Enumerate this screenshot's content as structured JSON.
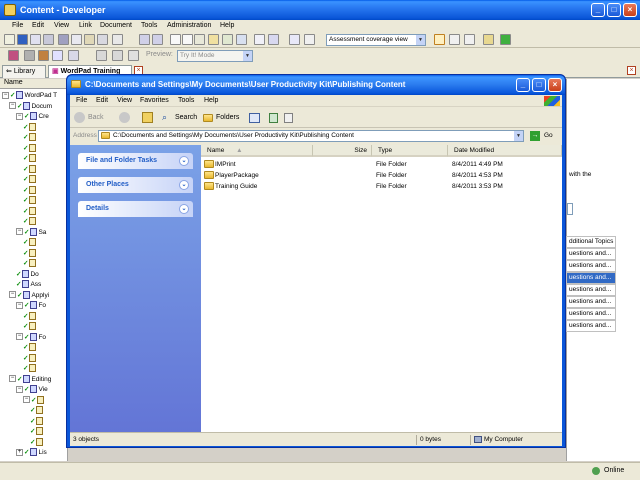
{
  "main_window": {
    "title": "Content - Developer",
    "menu": [
      "File",
      "Edit",
      "View",
      "Link",
      "Document",
      "Tools",
      "Administration",
      "Help"
    ],
    "preview_label": "Preview:",
    "preview_value": "Try It! Mode",
    "view_select": "Assessment coverage view"
  },
  "tabs": {
    "library": "Library",
    "active": "WordPad Training"
  },
  "tree": {
    "header": "Name",
    "rows": [
      {
        "label": "WordPad T",
        "indent": 0,
        "expander": "−"
      },
      {
        "label": "Docum",
        "indent": 1,
        "expander": "−"
      },
      {
        "label": "Cre",
        "indent": 2,
        "expander": "−"
      },
      {
        "label": "",
        "indent": 3,
        "expander": ""
      },
      {
        "label": "",
        "indent": 3,
        "expander": ""
      },
      {
        "label": "",
        "indent": 3,
        "expander": ""
      },
      {
        "label": "",
        "indent": 3,
        "expander": ""
      },
      {
        "label": "",
        "indent": 3,
        "expander": ""
      },
      {
        "label": "",
        "indent": 3,
        "expander": ""
      },
      {
        "label": "",
        "indent": 3,
        "expander": ""
      },
      {
        "label": "",
        "indent": 3,
        "expander": ""
      },
      {
        "label": "",
        "indent": 3,
        "expander": ""
      },
      {
        "label": "",
        "indent": 3,
        "expander": ""
      },
      {
        "label": "Sa",
        "indent": 2,
        "expander": "−"
      },
      {
        "label": "",
        "indent": 3,
        "expander": ""
      },
      {
        "label": "",
        "indent": 3,
        "expander": ""
      },
      {
        "label": "",
        "indent": 3,
        "expander": ""
      },
      {
        "label": "Do",
        "indent": 2,
        "expander": ""
      },
      {
        "label": "Ass",
        "indent": 2,
        "expander": ""
      },
      {
        "label": "Applyi",
        "indent": 1,
        "expander": "−"
      },
      {
        "label": "Fo",
        "indent": 2,
        "expander": "−"
      },
      {
        "label": "",
        "indent": 3,
        "expander": ""
      },
      {
        "label": "",
        "indent": 3,
        "expander": ""
      },
      {
        "label": "Fo",
        "indent": 2,
        "expander": "−"
      },
      {
        "label": "",
        "indent": 3,
        "expander": ""
      },
      {
        "label": "",
        "indent": 3,
        "expander": ""
      },
      {
        "label": "",
        "indent": 3,
        "expander": ""
      },
      {
        "label": "Editing",
        "indent": 1,
        "expander": "−"
      },
      {
        "label": "Vie",
        "indent": 2,
        "expander": "−"
      },
      {
        "label": "",
        "indent": 3,
        "expander": "−"
      },
      {
        "label": "",
        "indent": 4,
        "expander": ""
      },
      {
        "label": "",
        "indent": 4,
        "expander": ""
      },
      {
        "label": "",
        "indent": 4,
        "expander": ""
      },
      {
        "label": "",
        "indent": 4,
        "expander": ""
      },
      {
        "label": "Lis",
        "indent": 2,
        "expander": "+"
      }
    ]
  },
  "right_panel": {
    "text_fragment": "with the",
    "rows": [
      "dditional Topics",
      "uestions and...",
      "uestions and...",
      "uestions and...",
      "uestions and...",
      "uestions and...",
      "uestions and...",
      "uestions and..."
    ],
    "selected_index": 3
  },
  "statusbar": {
    "online": "Online"
  },
  "explorer": {
    "title": "C:\\Documents and Settings\\My Documents\\User Productivity Kit\\Publishing Content",
    "menu": [
      "File",
      "Edit",
      "View",
      "Favorites",
      "Tools",
      "Help"
    ],
    "toolbar": {
      "back": "Back",
      "search": "Search",
      "folders": "Folders"
    },
    "address_label": "Address",
    "address_value": "C:\\Documents and Settings\\My Documents\\User Productivity Kit\\Publishing Content",
    "go": "Go",
    "tasks": [
      "File and Folder Tasks",
      "Other Places",
      "Details"
    ],
    "columns": [
      "Name",
      "Size",
      "Type",
      "Date Modified"
    ],
    "files": [
      {
        "name": "IMPrint",
        "size": "",
        "type": "File Folder",
        "date": "8/4/2011 4:49 PM"
      },
      {
        "name": "PlayerPackage",
        "size": "",
        "type": "File Folder",
        "date": "8/4/2011 4:53 PM"
      },
      {
        "name": "Training Guide",
        "size": "",
        "type": "File Folder",
        "date": "8/4/2011 3:53 PM"
      }
    ],
    "status": {
      "objects": "3 objects",
      "bytes": "0 bytes",
      "location": "My Computer"
    }
  },
  "colors": {
    "xp_blue": "#0a56d8",
    "task_pane": "#6375d6",
    "selection": "#316ac5"
  }
}
